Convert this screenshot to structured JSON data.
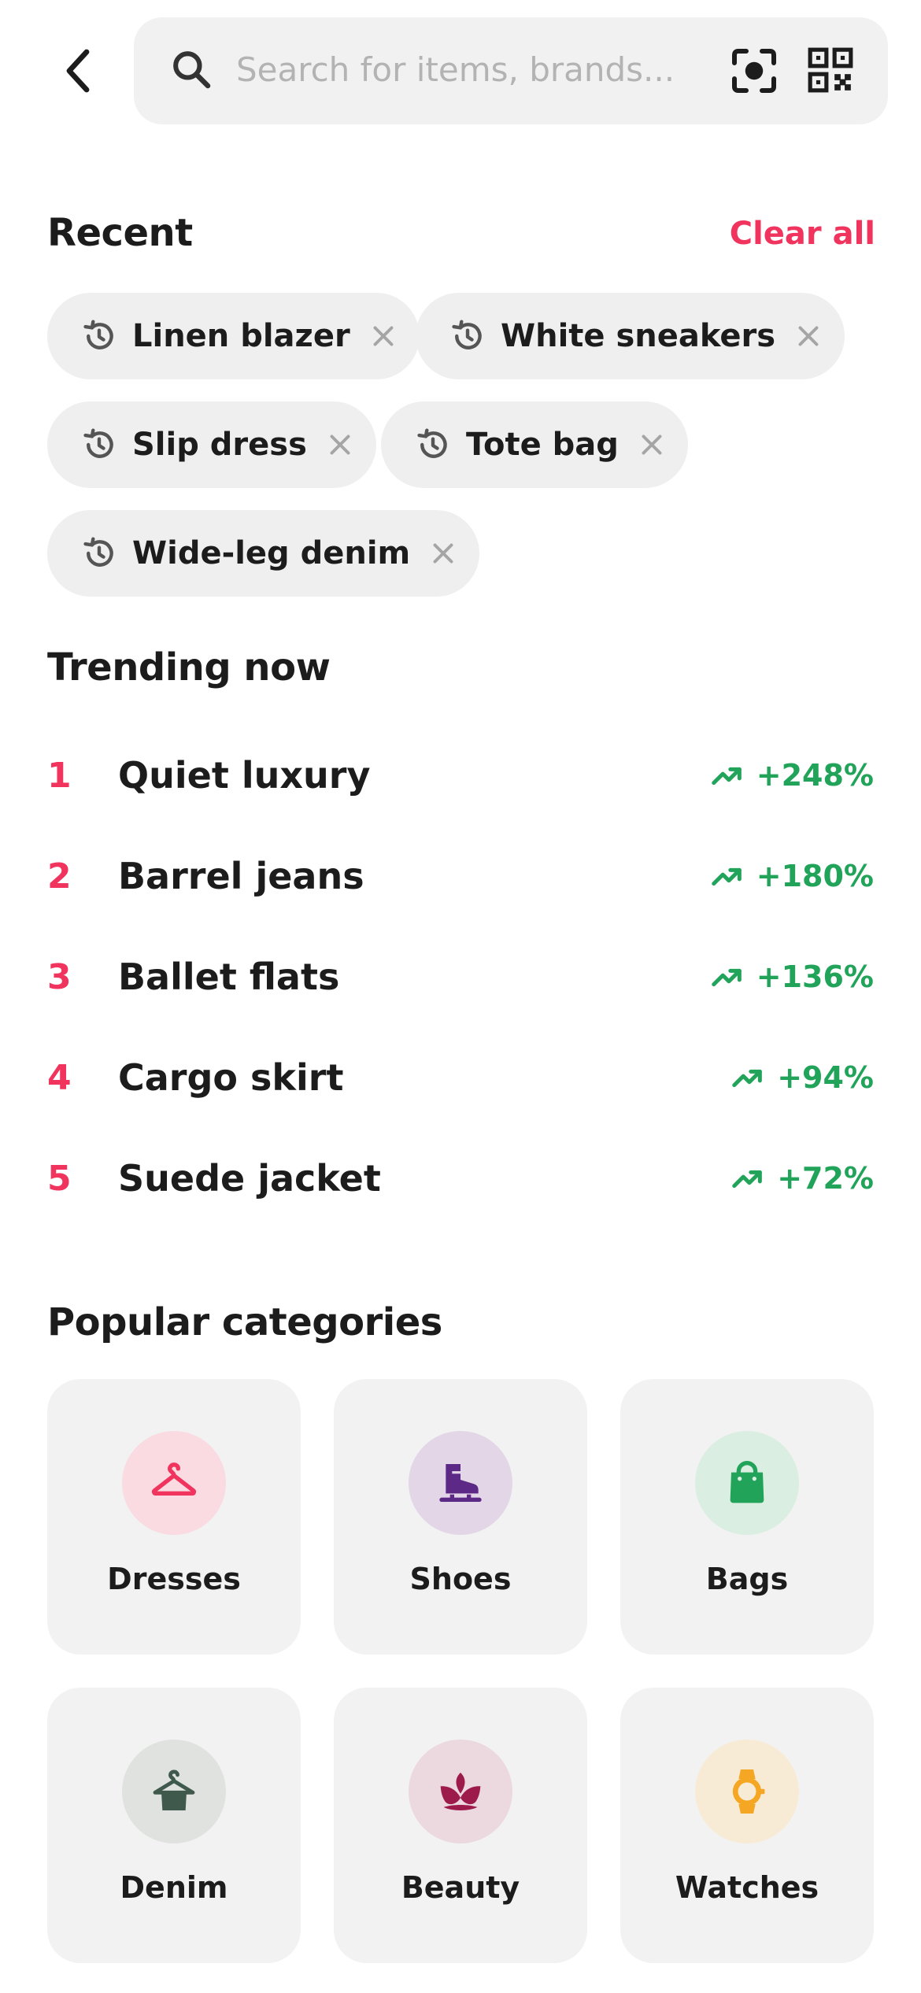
{
  "header": {
    "search": {
      "placeholder": "Search for items, brands..."
    }
  },
  "recent": {
    "title": "Recent",
    "clear_label": "Clear all",
    "items": [
      {
        "label": "Linen blazer"
      },
      {
        "label": "White sneakers"
      },
      {
        "label": "Slip dress"
      },
      {
        "label": "Tote bag"
      },
      {
        "label": "Wide-leg denim"
      }
    ]
  },
  "trending": {
    "title": "Trending now",
    "items": [
      {
        "rank": "1",
        "name": "Quiet luxury",
        "change": "+248%"
      },
      {
        "rank": "2",
        "name": "Barrel jeans",
        "change": "+180%"
      },
      {
        "rank": "3",
        "name": "Ballet flats",
        "change": "+136%"
      },
      {
        "rank": "4",
        "name": "Cargo skirt",
        "change": "+94%"
      },
      {
        "rank": "5",
        "name": "Suede jacket",
        "change": "+72%"
      }
    ]
  },
  "categories": {
    "title": "Popular categories",
    "items": [
      {
        "label": "Dresses",
        "icon": "hanger-icon",
        "color": "#f0345e",
        "bg": "#f9dbe1"
      },
      {
        "label": "Shoes",
        "icon": "boot-icon",
        "color": "#5c2a86",
        "bg": "#e3d6e6"
      },
      {
        "label": "Bags",
        "icon": "shopping-bag-icon",
        "color": "#21a35a",
        "bg": "#dbeee2"
      },
      {
        "label": "Denim",
        "icon": "hanger-shirt-icon",
        "color": "#3f5a4d",
        "bg": "#dfe2df"
      },
      {
        "label": "Beauty",
        "icon": "lotus-icon",
        "color": "#9c1b4a",
        "bg": "#ecd8df"
      },
      {
        "label": "Watches",
        "icon": "watch-icon",
        "color": "#f5a623",
        "bg": "#f8ebd6"
      }
    ]
  },
  "colors": {
    "accent": "#f0345e",
    "positive": "#21a35a"
  }
}
